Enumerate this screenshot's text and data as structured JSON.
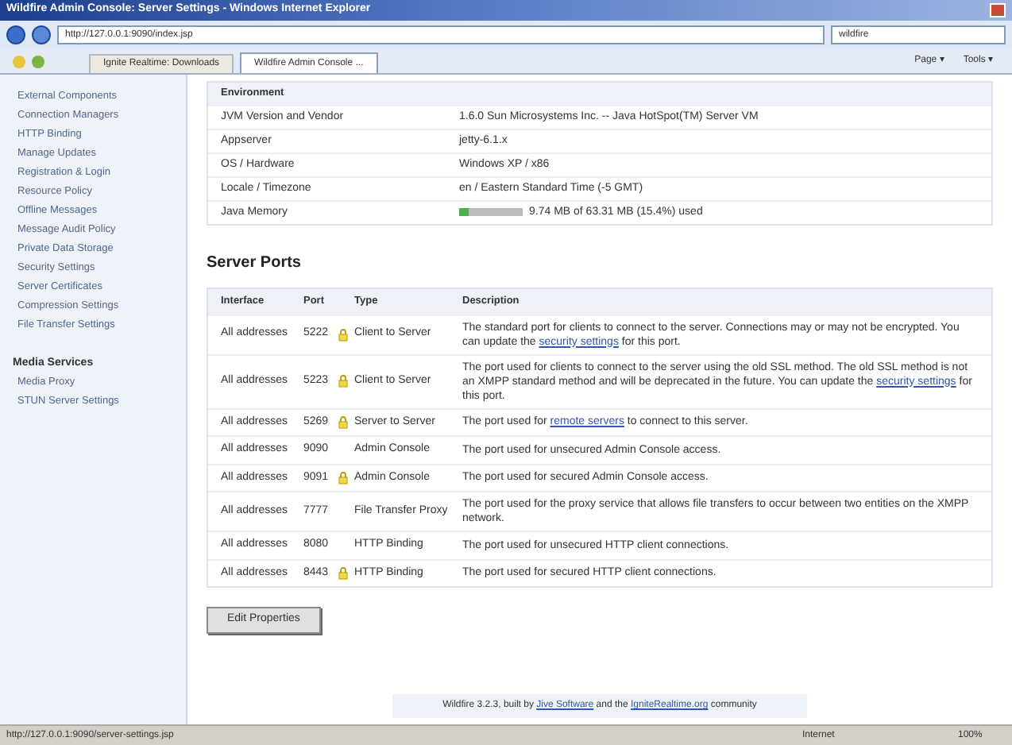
{
  "window": {
    "title": "Wildfire Admin Console: Server Settings - Windows Internet Explorer"
  },
  "address_bar": {
    "url": "http://127.0.0.1:9090/index.jsp",
    "search": "wildfire"
  },
  "tabs": [
    {
      "label": "Ignite Realtime: Downloads",
      "selected": false
    },
    {
      "label": "Wildfire Admin Console ...",
      "selected": true
    }
  ],
  "toolbar": [
    {
      "label": "Page",
      "caret": "▾"
    },
    {
      "label": "Tools",
      "caret": "▾"
    }
  ],
  "sidebar": {
    "groups": [
      {
        "items": [
          "External Components",
          "Connection Managers",
          "HTTP Binding",
          "Manage Updates",
          "Registration & Login",
          "Resource Policy",
          "Offline Messages",
          "Message Audit Policy",
          "Private Data Storage",
          "Security Settings",
          "Server Certificates",
          "Compression Settings",
          "File Transfer Settings"
        ]
      },
      {
        "title": "Media Services",
        "items": [
          "Media Proxy",
          "STUN Server Settings"
        ]
      }
    ]
  },
  "environment": {
    "title": "Environment",
    "rows": [
      {
        "label": "JVM Version and Vendor",
        "value": "1.6.0 Sun Microsystems Inc. -- Java HotSpot(TM) Server VM"
      },
      {
        "label": "Appserver",
        "value": "jetty-6.1.x"
      },
      {
        "label": "OS / Hardware",
        "value": "Windows XP / x86"
      },
      {
        "label": "Locale / Timezone",
        "value": "en / Eastern Standard Time (-5 GMT)"
      },
      {
        "label": "Java Memory",
        "value": "9.74 MB of 63.31 MB (15.4%) used",
        "level": 0.154
      }
    ]
  },
  "server_ports": {
    "title": "Server Ports",
    "columns": [
      "Interface",
      "Port",
      "Type",
      "Description"
    ],
    "rows": [
      {
        "interface": "All addresses",
        "port": "5222",
        "secure": true,
        "type": "Client to Server",
        "description": [
          {
            "text": "The standard port for clients to connect to the server. Connections may or may not be encrypted. You can update the "
          },
          {
            "text": "security settings",
            "link": true
          },
          {
            "text": " for this port."
          }
        ]
      },
      {
        "interface": "All addresses",
        "port": "5223",
        "secure": true,
        "type": "Client to Server",
        "description": [
          {
            "text": "The port used for clients to connect to the server using the old SSL method. The old SSL method is not an XMPP standard method and will be deprecated in the future. You can update the "
          },
          {
            "text": "security settings",
            "link": true
          },
          {
            "text": " for this port."
          }
        ]
      },
      {
        "interface": "All addresses",
        "port": "5269",
        "secure": true,
        "type": "Server to Server",
        "description": [
          {
            "text": "The port used for "
          },
          {
            "text": "remote servers",
            "link": true
          },
          {
            "text": " to connect to this server."
          }
        ]
      },
      {
        "interface": "All addresses",
        "port": "9090",
        "secure": false,
        "type": "Admin Console",
        "description": [
          {
            "text": "The port used for unsecured Admin Console access."
          }
        ]
      },
      {
        "interface": "All addresses",
        "port": "9091",
        "secure": true,
        "type": "Admin Console",
        "description": [
          {
            "text": "The port used for secured Admin Console access."
          }
        ]
      },
      {
        "interface": "All addresses",
        "port": "7777",
        "secure": false,
        "type": "File Transfer Proxy",
        "description": [
          {
            "text": "The port used for the proxy service that allows file transfers to occur between two entities on the XMPP network."
          }
        ]
      },
      {
        "interface": "All addresses",
        "port": "8080",
        "secure": false,
        "type": "HTTP Binding",
        "description": [
          {
            "text": "The port used for unsecured HTTP client connections."
          }
        ]
      },
      {
        "interface": "All addresses",
        "port": "8443",
        "secure": true,
        "type": "HTTP Binding",
        "description": [
          {
            "text": "The port used for secured HTTP client connections."
          }
        ]
      }
    ]
  },
  "edit_button": "Edit Properties",
  "footer": [
    {
      "text": "Wildfire 3.2.3, built by "
    },
    {
      "text": "Jive Software",
      "link": true
    },
    {
      "text": " and the "
    },
    {
      "text": "IgniteRealtime.org",
      "link": true
    },
    {
      "text": " community"
    }
  ],
  "status_bar": {
    "url": "http://127.0.0.1:9090/server-settings.jsp",
    "zone": "Internet",
    "zoom": "100%"
  }
}
